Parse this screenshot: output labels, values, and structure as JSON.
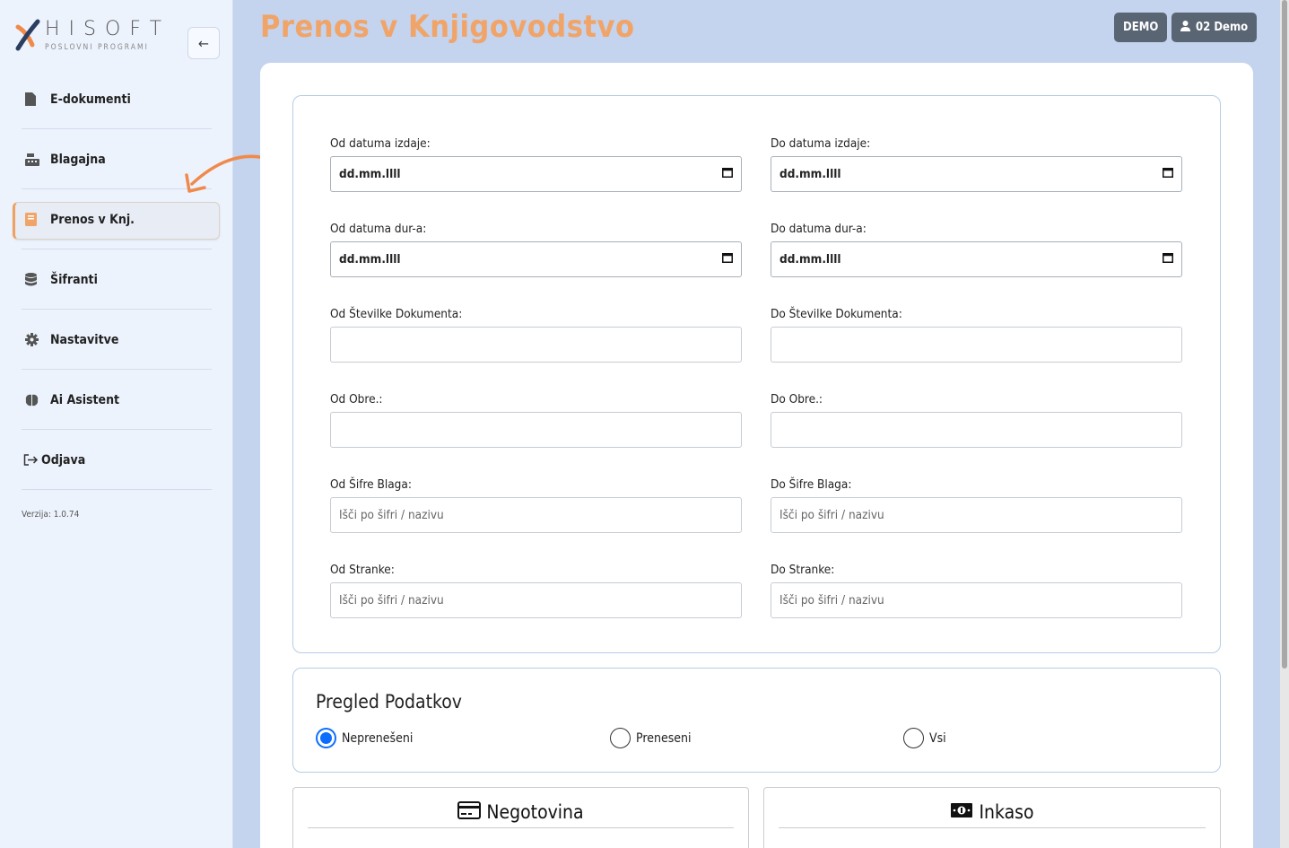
{
  "app": {
    "brand": "HISOFT",
    "tagline": "POSLOVNI PROGRAMI",
    "version": "Verzija: 1.0.74"
  },
  "sidebar": {
    "items": [
      {
        "label": "E-dokumenti",
        "icon": "file-icon"
      },
      {
        "label": "Blagajna",
        "icon": "cash-register-icon"
      },
      {
        "label": "Prenos v Knj.",
        "icon": "book-icon",
        "active": true
      },
      {
        "label": "Šifranti",
        "icon": "database-icon"
      },
      {
        "label": "Nastavitve",
        "icon": "gear-icon"
      },
      {
        "label": "Ai Asistent",
        "icon": "brain-icon"
      },
      {
        "label": "Odjava",
        "icon": "logout-icon"
      }
    ]
  },
  "header": {
    "title": "Prenos v Knjigovodstvo",
    "env_badge": "DEMO",
    "user_label": "02 Demo"
  },
  "filters": {
    "od_izdaje_label": "Od datuma izdaje:",
    "do_izdaje_label": "Do datuma izdaje:",
    "od_dur_label": "Od datuma dur-a:",
    "do_dur_label": "Do datuma dur-a:",
    "date_placeholder": "dd.mm.llll",
    "od_stevilke_label": "Od Številke Dokumenta:",
    "do_stevilke_label": "Do Številke Dokumenta:",
    "od_obre_label": "Od Obre.:",
    "do_obre_label": "Do Obre.:",
    "od_sifre_label": "Od Šifre Blaga:",
    "do_sifre_label": "Do Šifre Blaga:",
    "od_stranke_label": "Od Stranke:",
    "do_stranke_label": "Do Stranke:",
    "search_placeholder": "Išči po šifri / nazivu"
  },
  "review": {
    "title": "Pregled Podatkov",
    "options": [
      "Neprenešeni",
      "Preneseni",
      "Vsi"
    ],
    "selected": "Neprenešeni"
  },
  "payments": {
    "cash_title": "Negotovina",
    "collection_title": "Inkaso"
  },
  "colors": {
    "accent": "#f0a468",
    "radio": "#0d6efd",
    "badge": "#5a6573"
  }
}
